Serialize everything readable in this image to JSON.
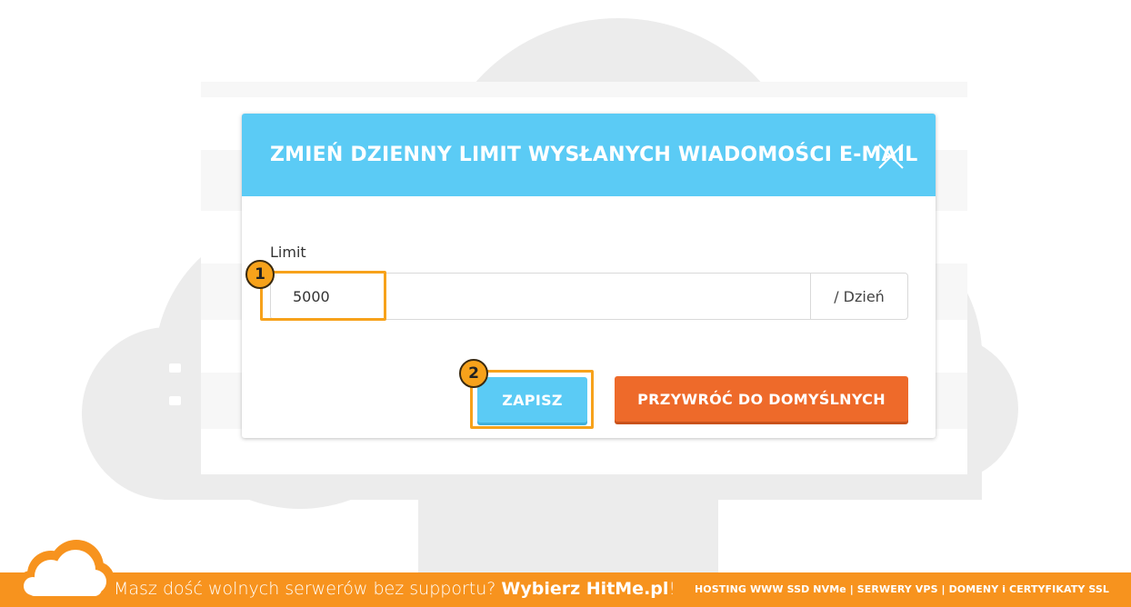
{
  "modal": {
    "title": "ZMIEŃ DZIENNY LIMIT WYSŁANYCH WIADOMOŚCI E-MAIL",
    "close_icon": "close-icon",
    "limit_label": "Limit",
    "limit_value": "5000",
    "limit_unit": "/ Dzień",
    "save_label": "ZAPISZ",
    "reset_label": "PRZYWRÓĆ DO DOMYŚLNYCH"
  },
  "annotations": {
    "step1": "1",
    "step2": "2"
  },
  "footer": {
    "tagline_prefix": "Masz dość wolnych serwerów bez supportu?",
    "tagline_brand": "Wybierz HitMe.pl",
    "tagline_suffix": "!",
    "links": "HOSTING WWW SSD NVMe | SERWERY VPS | DOMENY i CERTYFIKATY SSL",
    "logo_icon": "cloud-logo-icon"
  },
  "colors": {
    "header": "#5bcbf5",
    "save_button": "#5bcbf5",
    "reset_button": "#ee6a2a",
    "highlight": "#f7a21b",
    "footer": "#f7931e"
  }
}
